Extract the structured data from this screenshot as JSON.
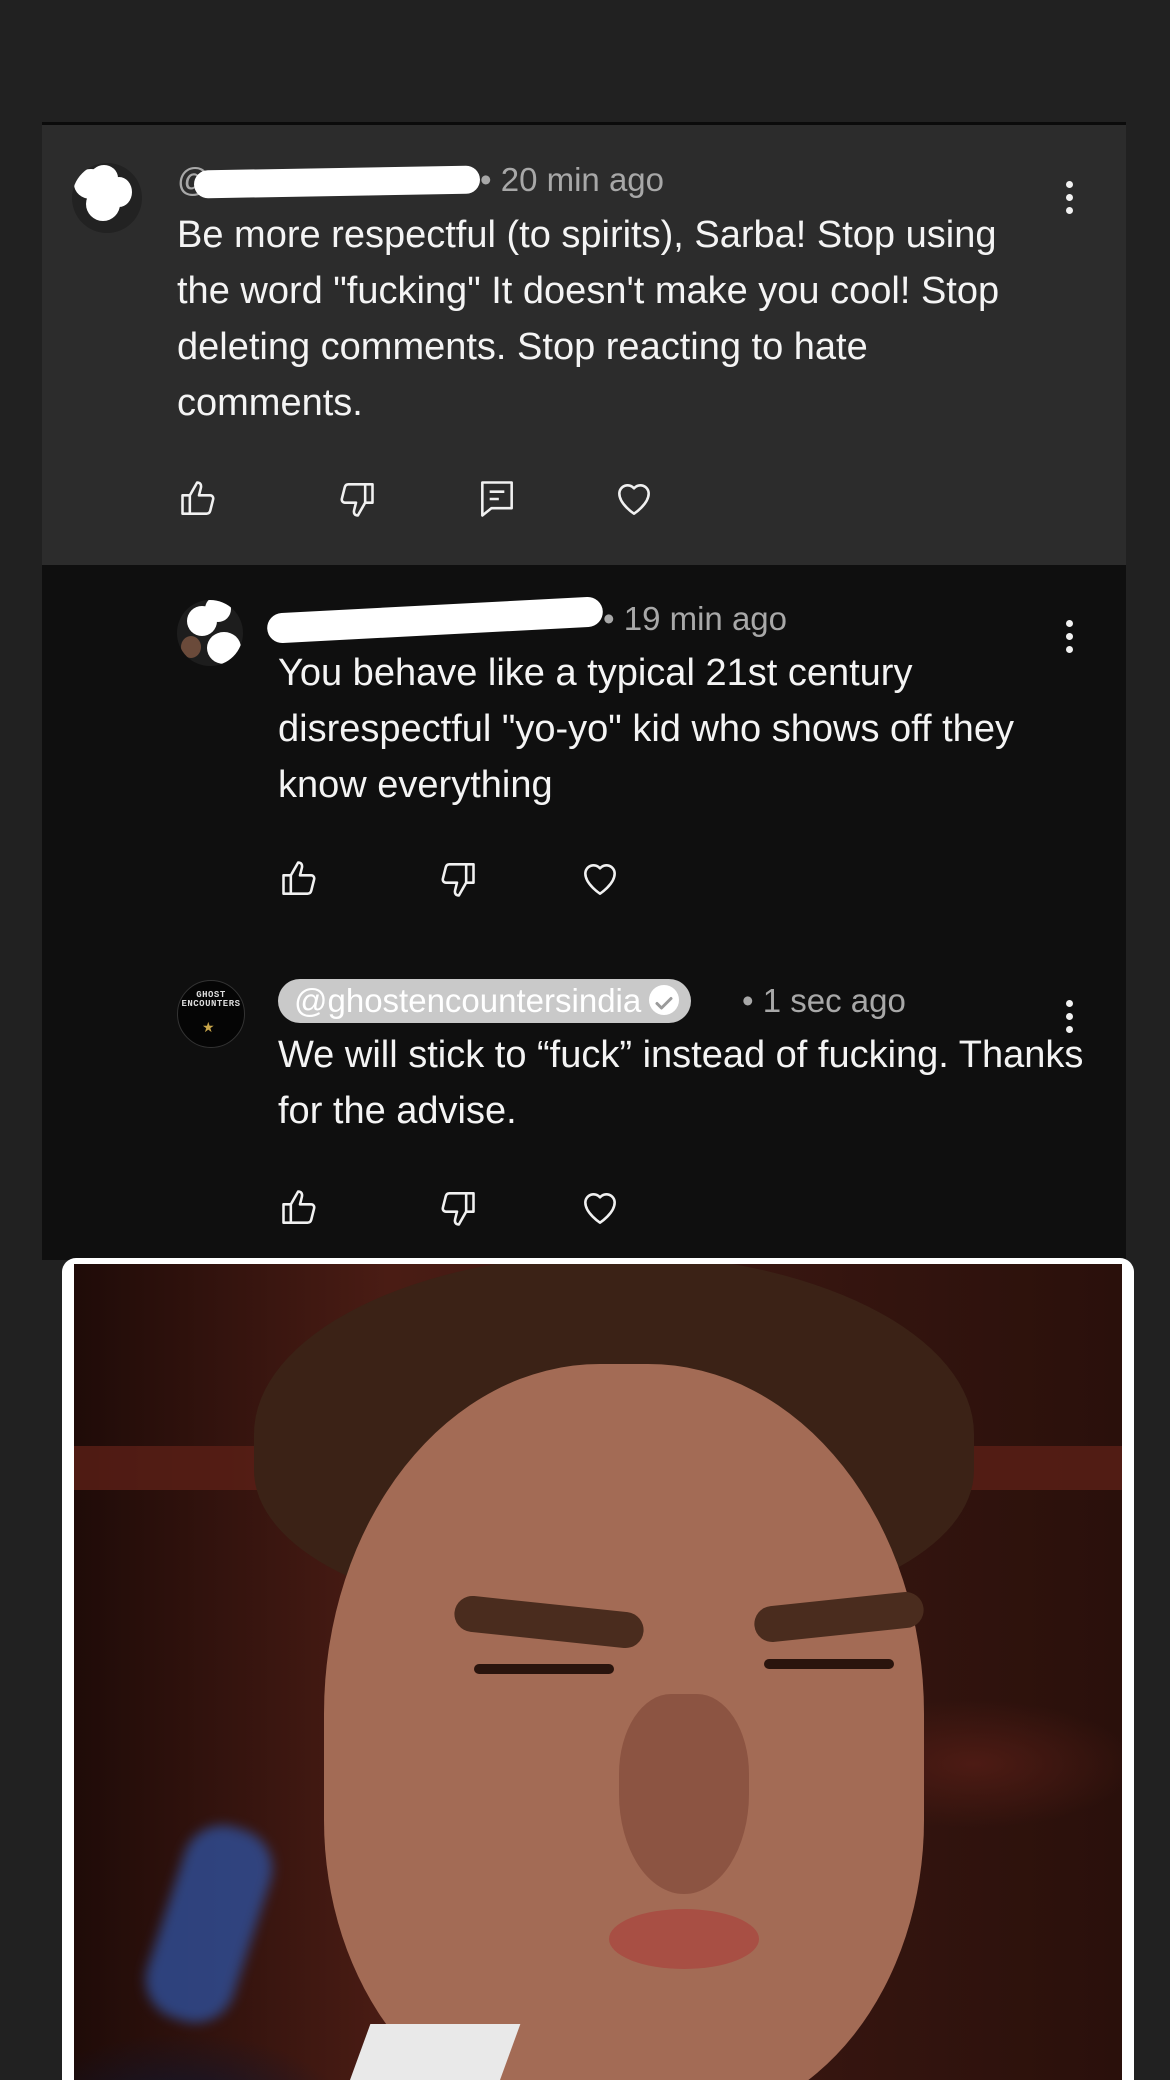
{
  "comments": [
    {
      "author_handle": "@",
      "timestamp": "• 20 min ago",
      "text": "Be more respectful (to spirits), Sarba! Stop using the word \"fucking\" It doesn't make you cool! Stop deleting comments. Stop reacting to hate comments.",
      "actions": [
        "thumbs-up-icon",
        "thumbs-down-icon",
        "reply-icon",
        "heart-icon"
      ]
    },
    {
      "author_handle": "",
      "timestamp": "• 19 min ago",
      "text": "You behave like a typical 21st century disrespectful \"yo-yo\" kid who shows off they know everything",
      "actions": [
        "thumbs-up-icon",
        "thumbs-down-icon",
        "heart-icon"
      ]
    },
    {
      "author_handle": "@ghostencountersindia",
      "avatar_text": "GHOST ENCOUNTERS",
      "timestamp": "• 1 sec ago",
      "text": "We will stick to “fuck” instead of fucking. Thanks for the advise.",
      "actions": [
        "thumbs-up-icon",
        "thumbs-down-icon",
        "heart-icon"
      ],
      "verified": true
    }
  ],
  "colors": {
    "background": "#212121",
    "highlighted_comment": "#2c2c2c",
    "reply_panel": "#0f0f0f",
    "handle_badge": "#c9c9c9",
    "text": "#f4f4f4",
    "meta": "#a8a8a8"
  }
}
